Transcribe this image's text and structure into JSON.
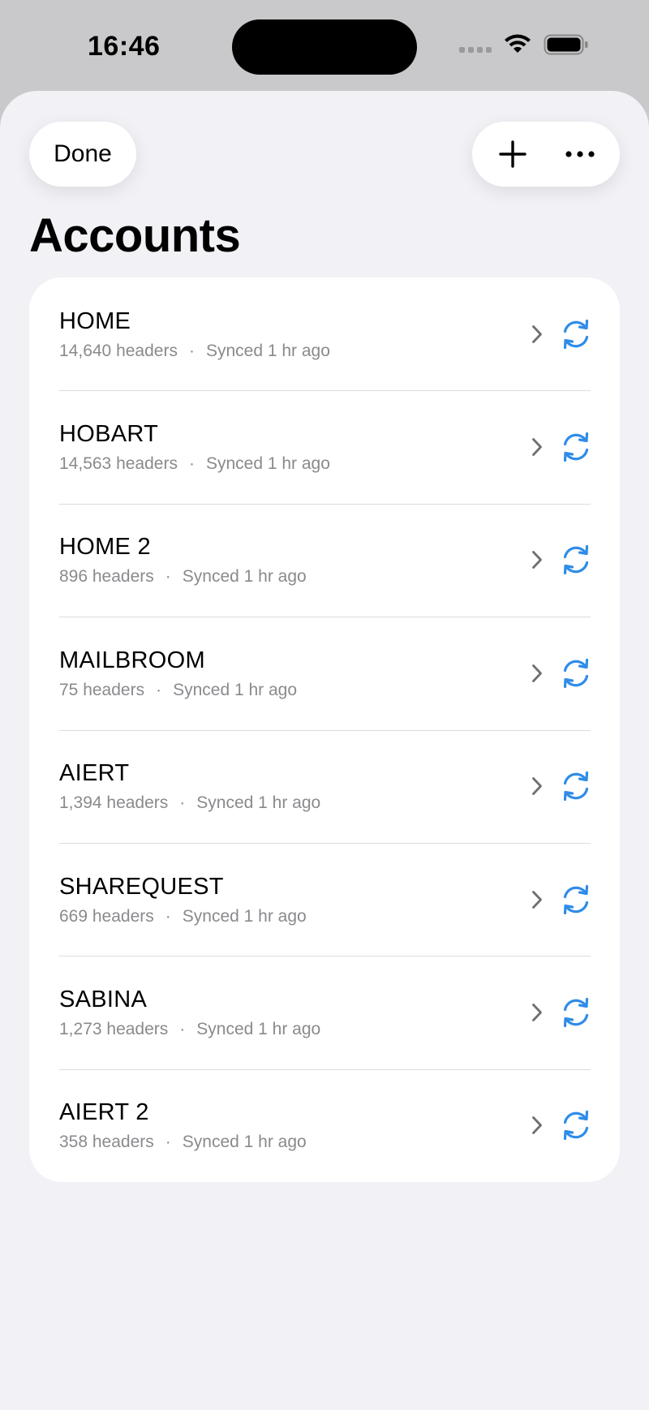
{
  "status_bar": {
    "time": "16:46"
  },
  "toolbar": {
    "done_label": "Done",
    "add_icon": "plus-icon",
    "more_icon": "ellipsis-icon"
  },
  "page": {
    "title": "Accounts"
  },
  "colors": {
    "accent": "#2f8ce8",
    "secondary_text": "#8a8a8e",
    "sheet_bg": "#f1f1f6"
  },
  "accounts": [
    {
      "name": "HOME",
      "headers": "14,640 headers",
      "synced": "Synced 1 hr ago"
    },
    {
      "name": "HOBART",
      "headers": "14,563 headers",
      "synced": "Synced 1 hr ago"
    },
    {
      "name": "HOME 2",
      "headers": "896 headers",
      "synced": "Synced 1 hr ago"
    },
    {
      "name": "MAILBROOM",
      "headers": "75 headers",
      "synced": "Synced 1 hr ago"
    },
    {
      "name": "AIERT",
      "headers": "1,394 headers",
      "synced": "Synced 1 hr ago"
    },
    {
      "name": "SHAREQUEST",
      "headers": "669 headers",
      "synced": "Synced 1 hr ago"
    },
    {
      "name": "SABINA",
      "headers": "1,273 headers",
      "synced": "Synced 1 hr ago"
    },
    {
      "name": "AIERT 2",
      "headers": "358 headers",
      "synced": "Synced 1 hr ago"
    }
  ],
  "separator": "·"
}
